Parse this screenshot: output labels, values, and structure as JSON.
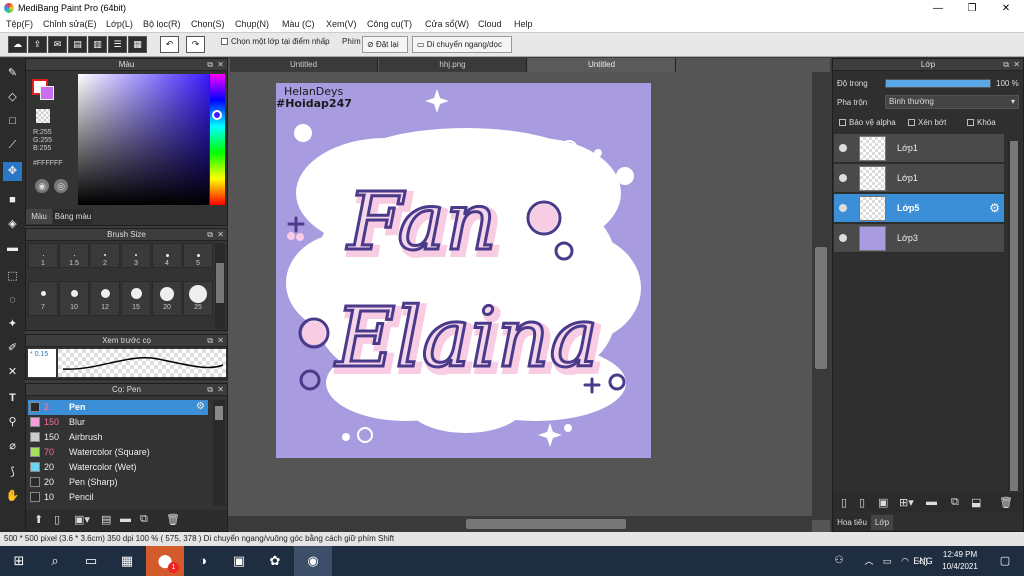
{
  "window": {
    "title": "MediBang Paint Pro (64bit)",
    "minimize": "—",
    "restore": "❐",
    "close": "✕"
  },
  "menu": [
    "Tệp(F)",
    "Chỉnh sửa(E)",
    "Lớp(L)",
    "Bộ lọc(R)",
    "Chọn(S)",
    "Chụp(N)",
    "Màu (C)",
    "Xem(V)",
    "Công cụ(T)",
    "Cửa sổ(W)",
    "Cloud",
    "Help"
  ],
  "toolbar": {
    "select_layer_label": "Chọn một lớp tại điểm nhấp",
    "snap_label": "Phím",
    "reset_label": "Đặt lại",
    "move_label": "Di chuyển ngang/dọc"
  },
  "color_panel": {
    "title": "Màu",
    "r": "R:255",
    "g": "G:255",
    "b": "B:255",
    "hex": "#FFFFFF",
    "tab_color": "Màu",
    "tab_palette": "Bảng màu",
    "primary": "#ffffff",
    "accent_secondary": "#c86ff0"
  },
  "brush_size_panel": {
    "title": "Brush Size",
    "sizes_row1": [
      "1",
      "1.5",
      "2",
      "3",
      "4",
      "5"
    ],
    "sizes_row2": [
      "7",
      "10",
      "12",
      "15",
      "20",
      "25"
    ]
  },
  "preview_panel": {
    "title": "Xem trước cọ",
    "value": "0.15"
  },
  "brush_panel": {
    "title": "Cọ: Pen",
    "brushes": [
      {
        "size": "2",
        "name": "Pen",
        "color": "#2b2b2b"
      },
      {
        "size": "150",
        "name": "Blur",
        "color": "#f5a0d8"
      },
      {
        "size": "150",
        "name": "Airbrush",
        "color": "#cccccc"
      },
      {
        "size": "70",
        "name": "Watercolor (Square)",
        "color": "#a6e05a"
      },
      {
        "size": "20",
        "name": "Watercolor (Wet)",
        "color": "#6fd3f5"
      },
      {
        "size": "20",
        "name": "Pen (Sharp)",
        "color": "#2b2b2b"
      },
      {
        "size": "10",
        "name": "Pencil",
        "color": "#2b2b2b"
      }
    ]
  },
  "tabs": [
    "Untitled",
    "hhj.png",
    "Untitled"
  ],
  "artwork": {
    "watermark_line1": "HelanDeys",
    "watermark_line2": "#Hoidap247",
    "word1": "Fan",
    "word2": "Elaina",
    "bg_color": "#a89be0",
    "cloud_color": "#ffffff",
    "text_color": "#4a3a8a",
    "fill_pink": "#f8cde4"
  },
  "layer_panel": {
    "title": "Lớp",
    "opacity_label": "Độ trong",
    "opacity_value": "100 %",
    "opacity": 1.0,
    "blend_label": "Pha trộn",
    "blend_value": "Bình thường",
    "protect_alpha": "Bảo vệ alpha",
    "clipping": "Xén bớt",
    "lock": "Khóa",
    "layers": [
      "Lớp1",
      "Lớp1",
      "Lớp5",
      "Lớp3"
    ],
    "tab_title": "Hoa tiêu",
    "tab_layer": "Lớp"
  },
  "statusbar": {
    "text": "500 * 500 pixel   (3.6 * 3.6cm)   350 dpi   100 %   ( 575, 378 )   Di chuyển ngang/vuông góc bằng cách giữ phím Shift"
  },
  "taskbar": {
    "time": "12:49 PM",
    "date": "10/4/2021",
    "lang": "ENG",
    "notification_count": "1"
  }
}
